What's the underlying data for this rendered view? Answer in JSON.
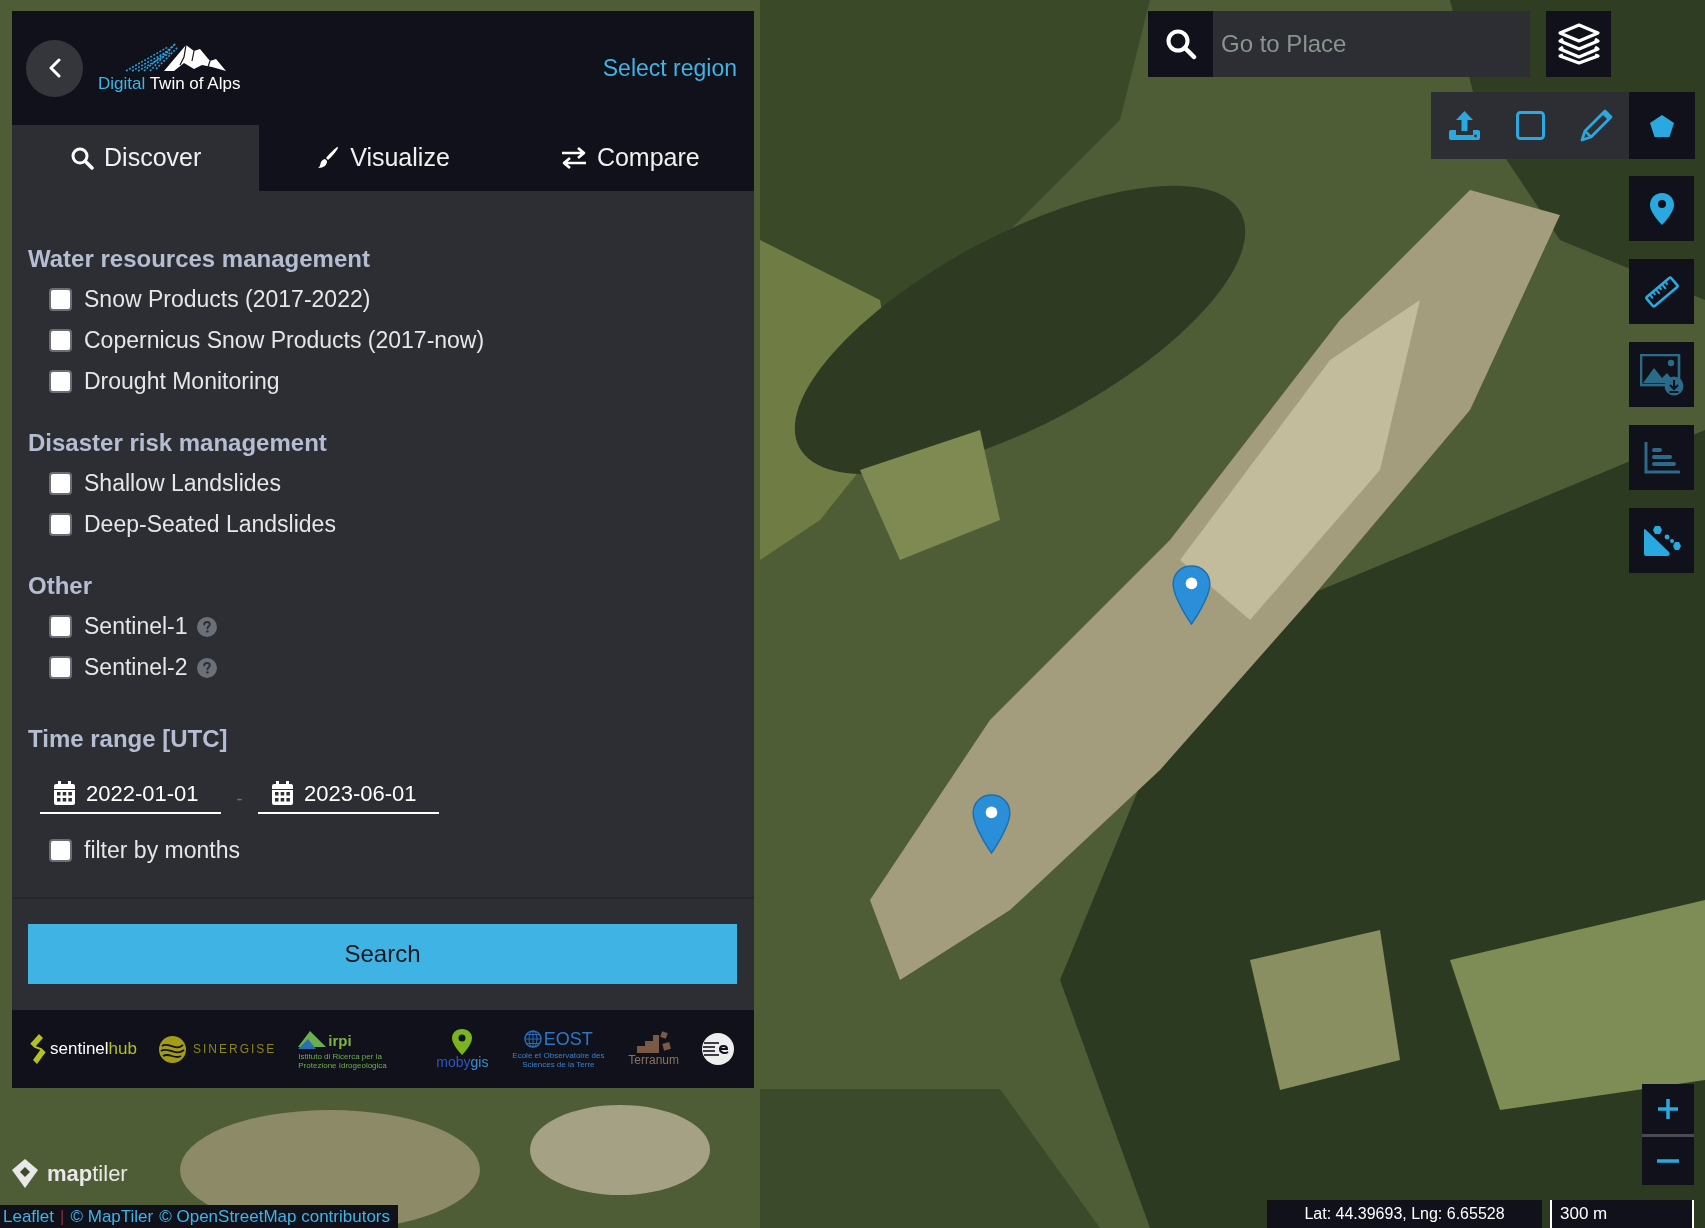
{
  "header": {
    "logo": {
      "accent": "Digital",
      "text": "Twin of Alps"
    },
    "region_link": "Select region"
  },
  "tabs": [
    {
      "kind": "search",
      "label": "Discover",
      "selected": true
    },
    {
      "kind": "brush",
      "label": "Visualize",
      "selected": false
    },
    {
      "kind": "compare",
      "label": "Compare",
      "selected": false
    }
  ],
  "groups": [
    {
      "title": "Water resources management",
      "items": [
        {
          "label": "Snow Products (2017-2022)",
          "checked": false
        },
        {
          "label": "Copernicus Snow Products (2017-now)",
          "checked": false
        },
        {
          "label": "Drought Monitoring",
          "checked": false
        }
      ]
    },
    {
      "title": "Disaster risk management",
      "items": [
        {
          "label": "Shallow Landslides",
          "checked": false
        },
        {
          "label": "Deep-Seated Landslides",
          "checked": false
        }
      ]
    },
    {
      "title": "Other",
      "items": [
        {
          "label": "Sentinel-1",
          "checked": false,
          "help": true
        },
        {
          "label": "Sentinel-2",
          "checked": false,
          "help": true
        }
      ]
    }
  ],
  "time_range": {
    "title": "Time range [UTC]",
    "from": "2022-01-01",
    "separator": "-",
    "to": "2023-06-01",
    "month_filter": {
      "label": "filter by months",
      "checked": false
    }
  },
  "search_button": {
    "label": "Search"
  },
  "partners": [
    {
      "kind": "sentinelhub",
      "text": "sentinel",
      "accent": "hub"
    },
    {
      "kind": "sinergise",
      "text": "SINERGISE"
    },
    {
      "kind": "irpi",
      "text": "irpi",
      "subtitle": "Istituto di Ricerca per la Protezione Idrogeologica"
    },
    {
      "kind": "mobygis",
      "text": "moby",
      "accent": "gis"
    },
    {
      "kind": "eost",
      "text": "EOST",
      "subtitle": "Ecole et Observatoire des Sciences de la Terre"
    },
    {
      "kind": "terranum",
      "text": "Terranum"
    },
    {
      "kind": "circle"
    }
  ],
  "place_search": {
    "placeholder": "Go to Place"
  },
  "draw_tools": [
    {
      "kind": "upload"
    },
    {
      "kind": "rectangle"
    },
    {
      "kind": "pencil"
    },
    {
      "kind": "polygon"
    }
  ],
  "map_tools": [
    {
      "kind": "marker",
      "disabled": false
    },
    {
      "kind": "ruler",
      "disabled": false
    },
    {
      "kind": "image-download",
      "disabled": true
    },
    {
      "kind": "histogram",
      "disabled": true
    },
    {
      "kind": "scatter",
      "disabled": false
    }
  ],
  "map_logo": "**map**tiler",
  "attribution": [
    {
      "kind": "link",
      "text": "Leaflet"
    },
    {
      "kind": "separator",
      "text": "|"
    },
    {
      "kind": "link",
      "text": "© MapTiler"
    },
    {
      "kind": "link",
      "text": "© OpenStreetMap contributors"
    }
  ],
  "coordinates": "Lat: 44.39693, Lng: 6.65528",
  "scale": "300 m"
}
